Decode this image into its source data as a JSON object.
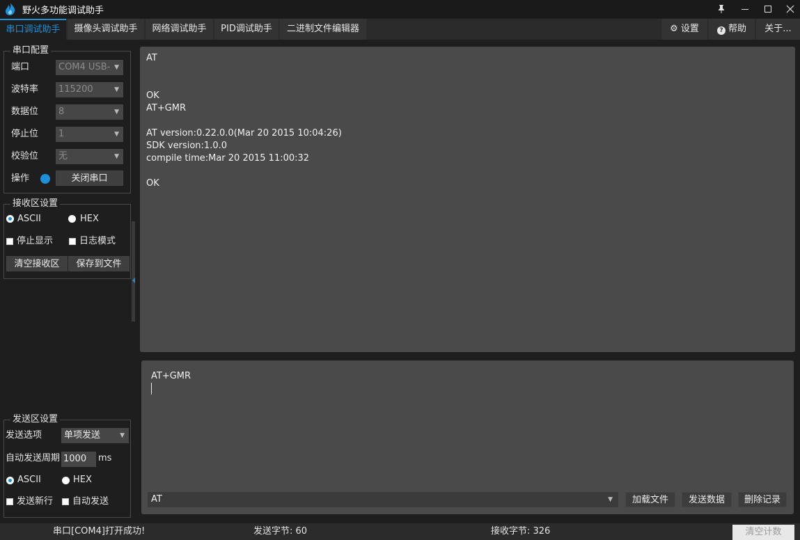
{
  "window": {
    "title": "野火多功能调试助手",
    "icons": [
      "pin-icon",
      "minimize-icon",
      "maximize-icon",
      "close-icon"
    ]
  },
  "tabs": [
    {
      "label": "串口调试助手",
      "active": true
    },
    {
      "label": "摄像头调试助手",
      "active": false
    },
    {
      "label": "网络调试助手",
      "active": false
    },
    {
      "label": "PID调试助手",
      "active": false
    },
    {
      "label": "二进制文件编辑器",
      "active": false
    }
  ],
  "top_buttons": {
    "settings": "设置",
    "help": "帮助",
    "about": "关于..."
  },
  "serial_config": {
    "title": "串口配置",
    "port_label": "端口",
    "port_value": "COM4 USB-",
    "baud_label": "波特率",
    "baud_value": "115200",
    "databits_label": "数据位",
    "databits_value": "8",
    "stopbits_label": "停止位",
    "stopbits_value": "1",
    "parity_label": "校验位",
    "parity_value": "无",
    "operation_label": "操作",
    "close_port_button": "关闭串口"
  },
  "receive_settings": {
    "title": "接收区设置",
    "ascii_label": "ASCII",
    "hex_label": "HEX",
    "stop_display_label": "停止显示",
    "log_mode_label": "日志模式",
    "clear_button": "清空接收区",
    "save_button": "保存到文件"
  },
  "send_settings": {
    "title": "发送区设置",
    "send_option_label": "发送选项",
    "send_option_value": "单项发送",
    "period_label": "自动发送周期",
    "period_value": "1000",
    "period_unit": "ms",
    "ascii_label": "ASCII",
    "hex_label": "HEX",
    "newline_label": "发送新行",
    "auto_send_label": "自动发送"
  },
  "receive_area": {
    "lines": [
      "AT",
      "",
      "",
      "OK",
      "AT+GMR",
      "",
      "AT version:0.22.0.0(Mar 20 2015 10:04:26)",
      "SDK version:1.0.0",
      "compile time:Mar 20 2015 11:00:32",
      "",
      "OK"
    ]
  },
  "send_area": {
    "text": "AT+GMR",
    "history_value": "AT",
    "load_file_button": "加载文件",
    "send_data_button": "发送数据",
    "delete_history_button": "删除记录"
  },
  "status_bar": {
    "port_status": "串口[COM4]打开成功!",
    "sent_bytes": "发送字节: 60",
    "received_bytes": "接收字节: 326",
    "clear_count_button": "清空计数"
  },
  "colors": {
    "accent": "#1e90d8",
    "background": "#1e1e1e",
    "panel": "#4a4a4a"
  }
}
